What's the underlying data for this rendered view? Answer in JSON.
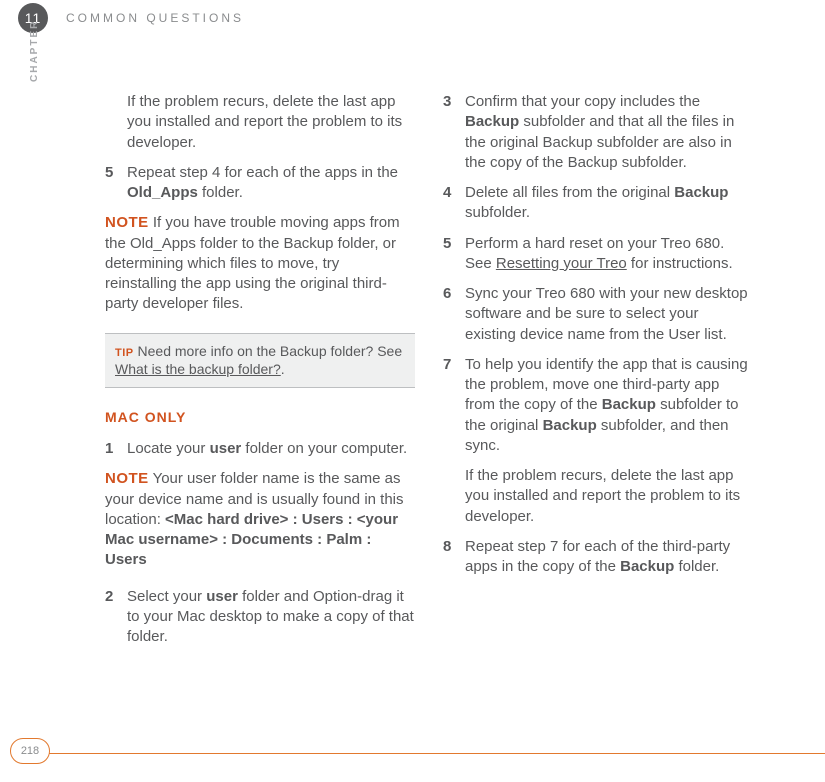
{
  "header": {
    "chapter_badge": "11",
    "section_title": "COMMON QUESTIONS",
    "chapter_sidelabel": "CHAPTER"
  },
  "left": {
    "para_recurs": "If the problem recurs, delete the last app you installed and report the problem to its developer.",
    "step5_num": "5",
    "step5_a": "Repeat step 4 for each of the apps in the ",
    "step5_b": "Old_Apps",
    "step5_c": " folder.",
    "note1_label": "NOTE",
    "note1_text": "  If you have trouble moving apps from the Old_Apps folder to the Backup folder, or determining which files to move, try reinstalling the app using the original third- party developer files.",
    "tip_label": "TIP",
    "tip_a": " Need more info on the Backup folder? See ",
    "tip_link": "What is the backup folder?",
    "tip_c": ".",
    "subhead": "MAC ONLY",
    "step1_num": "1",
    "step1_a": "Locate your ",
    "step1_b": "user",
    "step1_c": " folder on your computer.",
    "note2_label": "NOTE",
    "note2_a": "  Your user folder name is the same as your device name and is usually found in this location: ",
    "note2_b": "<Mac hard drive> : Users : <your Mac username> : Documents : Palm : Users",
    "step2_num": "2",
    "step2_a": "Select your ",
    "step2_b": "user",
    "step2_c": " folder and Option-drag it to your Mac desktop to make a copy of that folder."
  },
  "right": {
    "step3_num": "3",
    "step3_a": "Confirm that your copy includes the ",
    "step3_b": "Backup",
    "step3_c": " subfolder and that all the files in the original Backup subfolder are also in the copy of the Backup subfolder.",
    "step4_num": "4",
    "step4_a": "Delete all files from the original ",
    "step4_b": "Backup",
    "step4_c": " subfolder.",
    "step5_num": "5",
    "step5_a": "Perform a hard reset on your Treo 680. See ",
    "step5_link": "Resetting your Treo",
    "step5_c": " for instructions.",
    "step6_num": "6",
    "step6_text": "Sync your Treo 680 with your new desktop software and be sure to select your existing device name from the User list.",
    "step7_num": "7",
    "step7_a": "To help you identify the app that is causing the problem, move one third-party app from the copy of the ",
    "step7_b": "Backup",
    "step7_c": " subfolder to the original ",
    "step7_d": "Backup",
    "step7_e": " subfolder, and then sync.",
    "step7_recurs": "If the problem recurs, delete the last app you installed and report the problem to its developer.",
    "step8_num": "8",
    "step8_a": "Repeat step 7 for each of the third-party apps in the copy of the ",
    "step8_b": "Backup",
    "step8_c": " folder."
  },
  "footer": {
    "page_number": "218"
  }
}
